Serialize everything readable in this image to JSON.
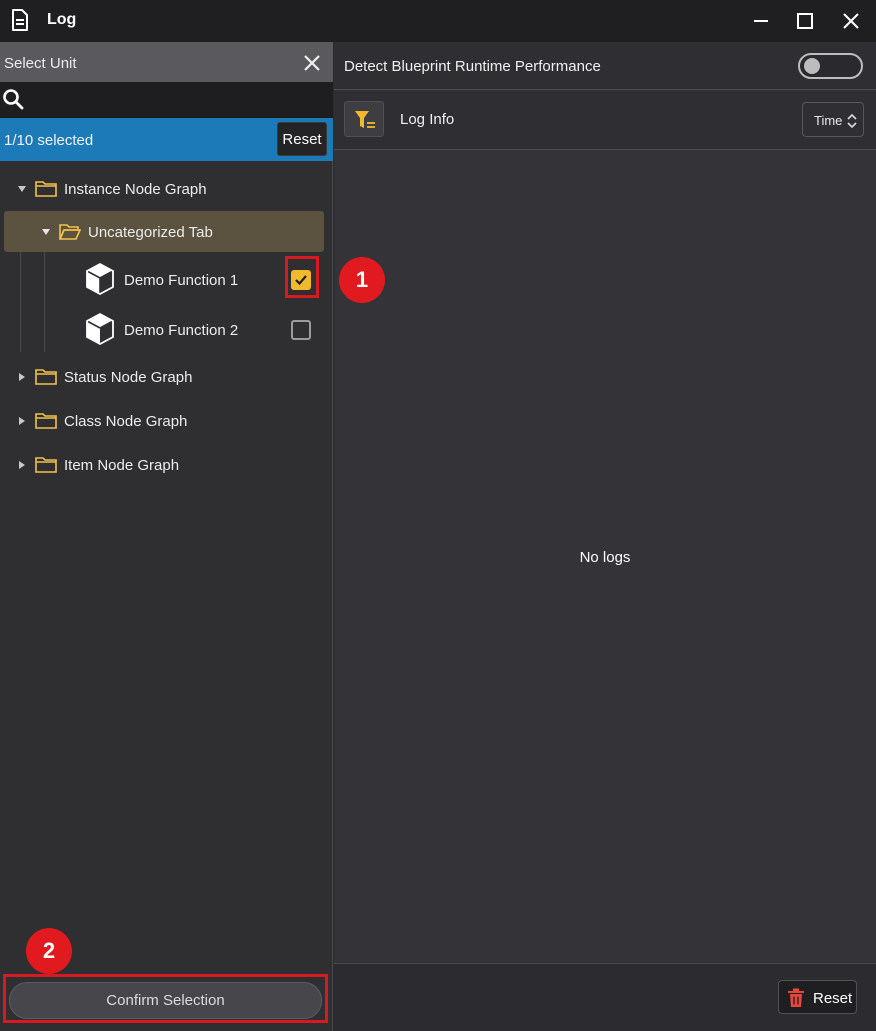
{
  "window": {
    "title": "Log"
  },
  "left_panel": {
    "header_label": "Select Unit",
    "selection_count": "1/10 selected",
    "reset_label": "Reset",
    "tree": {
      "instance_node_graph": "Instance Node Graph",
      "uncategorized_tab": "Uncategorized Tab",
      "demo_function_1": "Demo Function 1",
      "demo_function_2": "Demo Function 2",
      "status_node_graph": "Status Node Graph",
      "class_node_graph": "Class Node Graph",
      "item_node_graph": "Item Node Graph"
    },
    "demo_function_1_checked": true,
    "demo_function_2_checked": false,
    "confirm_label": "Confirm Selection"
  },
  "right_panel": {
    "detect_label": "Detect Blueprint Runtime Performance",
    "detect_enabled": false,
    "log_info_label": "Log Info",
    "sort_value": "Time",
    "empty_message": "No logs",
    "reset_label": "Reset"
  },
  "annotations": {
    "step1": "1",
    "step2": "2"
  },
  "colors": {
    "accent_blue": "#1c7ab8",
    "checkbox_gold": "#f2b92e",
    "annotation_red": "#e01a1f"
  }
}
